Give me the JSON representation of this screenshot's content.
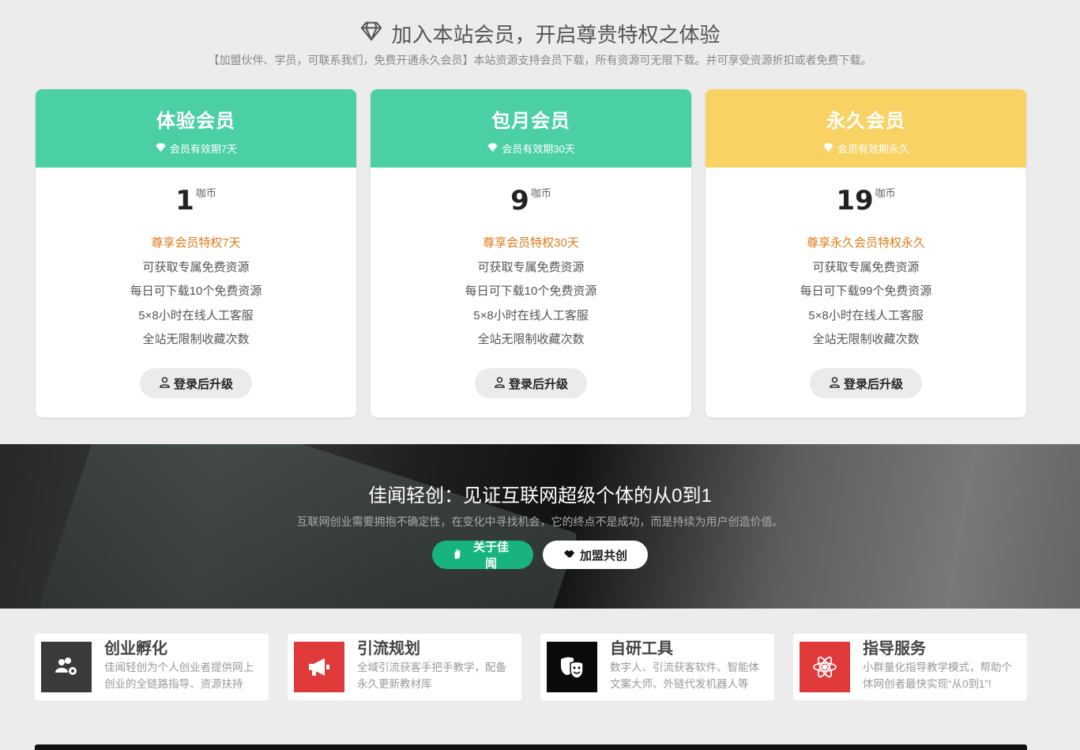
{
  "vip": {
    "title": "加入本站会员，开启尊贵特权之体验",
    "subtitle": "【加盟伙伴、学员，可联系我们，免费开通永久会员】本站资源支持会员下载，所有资源可无限下载。并可享受资源折扣或者免费下载。"
  },
  "plans": [
    {
      "name": "体验会员",
      "validity": "会员有效期7天",
      "price": "1",
      "unit": "咖币",
      "highlight": "尊享会员特权7天",
      "features": [
        "可获取专属免费资源",
        "每日可下载10个免费资源",
        "5×8小时在线人工客服",
        "全站无限制收藏次数"
      ],
      "button": "登录后升级",
      "color": "#4bcfa5"
    },
    {
      "name": "包月会员",
      "validity": "会员有效期30天",
      "price": "9",
      "unit": "咖币",
      "highlight": "尊享会员特权30天",
      "features": [
        "可获取专属免费资源",
        "每日可下载10个免费资源",
        "5×8小时在线人工客服",
        "全站无限制收藏次数"
      ],
      "button": "登录后升级",
      "color": "#4bcfa5"
    },
    {
      "name": "永久会员",
      "validity": "会员有效期永久",
      "price": "19",
      "unit": "咖币",
      "highlight": "尊享永久会员特权永久",
      "features": [
        "可获取专属免费资源",
        "每日可下载99个免费资源",
        "5×8小时在线人工客服",
        "全站无限制收藏次数"
      ],
      "button": "登录后升级",
      "color": "#f9d264"
    }
  ],
  "banner": {
    "title": "佳闻轻创：见证互联网超级个体的从0到1",
    "subtitle": "互联网创业需要拥抱不确定性，在变化中寻找机会，它的终点不是成功，而是持续为用户创造价值。",
    "btn_about": "关于佳闻",
    "btn_join": "加盟共创"
  },
  "services": [
    {
      "title": "创业孵化",
      "desc": "佳闻轻创为个人创业者提供网上创业的全链路指导、资源扶持",
      "icon": "users-gear-icon",
      "bg": "#3a3a3a"
    },
    {
      "title": "引流规划",
      "desc": "全域引流获客手把手教学，配备永久更新教材库",
      "icon": "megaphone-icon",
      "bg": "#e03a3a"
    },
    {
      "title": "自研工具",
      "desc": "数字人、引流获客软件、智能体文案大师、外链代发机器人等",
      "icon": "masks-icon",
      "bg": "#0a0a0a"
    },
    {
      "title": "指导服务",
      "desc": "小群量化指导教学模式，帮助个体网创者最快实现“从0到1”!",
      "icon": "atom-icon",
      "bg": "#e03a3a"
    }
  ]
}
